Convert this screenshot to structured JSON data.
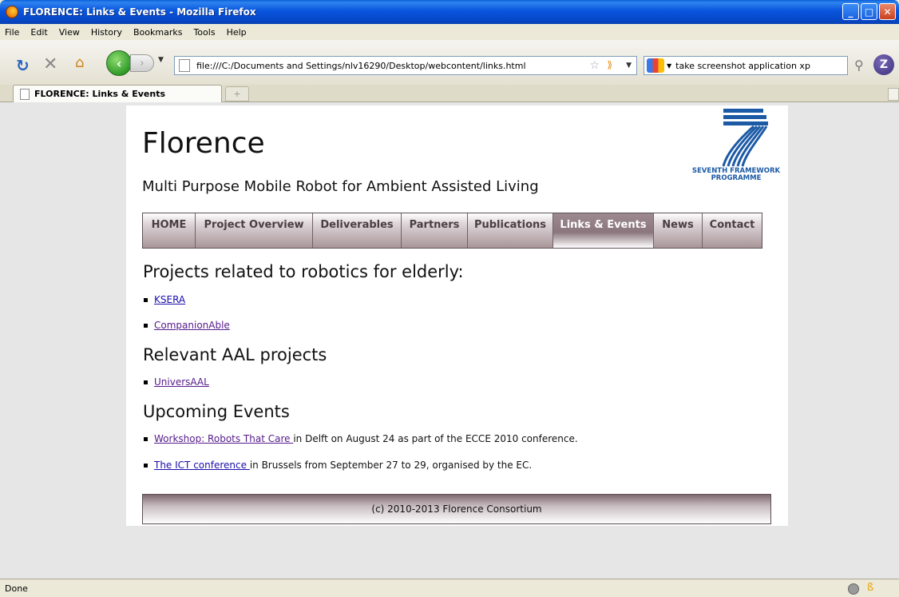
{
  "window": {
    "title": "FLORENCE: Links & Events - Mozilla Firefox"
  },
  "menu": [
    "File",
    "Edit",
    "View",
    "History",
    "Bookmarks",
    "Tools",
    "Help"
  ],
  "toolbar": {
    "url": "file:///C:/Documents and Settings/nlv16290/Desktop/webcontent/links.html",
    "search_value": "take screenshot application xp"
  },
  "tabs": [
    {
      "label": "FLORENCE: Links & Events"
    }
  ],
  "site": {
    "title": "Florence",
    "subtitle": "Multi Purpose Mobile Robot for Ambient Assisted Living",
    "logo_text_line1": "SEVENTH FRAMEWORK",
    "logo_text_line2": "PROGRAMME"
  },
  "nav": [
    {
      "label": "HOME",
      "active": false
    },
    {
      "label": "Project Overview",
      "active": false
    },
    {
      "label": "Deliverables",
      "active": false
    },
    {
      "label": "Partners",
      "active": false
    },
    {
      "label": "Publications",
      "active": false
    },
    {
      "label": "Links & Events",
      "active": true
    },
    {
      "label": "News",
      "active": false
    },
    {
      "label": "Contact",
      "active": false
    }
  ],
  "sections": {
    "robotics_heading": "Projects related to robotics for elderly:",
    "robotics_links": [
      "KSERA",
      "CompanionAble"
    ],
    "aal_heading": "Relevant AAL projects",
    "aal_links": [
      "UniversAAL"
    ],
    "events_heading": "Upcoming Events",
    "events": [
      {
        "link": "Workshop: Robots That Care ",
        "text": "in Delft on August 24 as part of the ECCE 2010 conference."
      },
      {
        "link": "The ICT conference ",
        "text": "in Brussels from September 27 to 29, organised by the EC."
      }
    ]
  },
  "footer": "(c) 2010-2013 Florence Consortium",
  "status": "Done",
  "icons": {
    "reload": "reload-icon",
    "stop": "stop-icon",
    "home": "home-icon",
    "back": "back-arrow-icon",
    "forward": "forward-arrow-icon",
    "bookmark_star": "star-icon",
    "rss": "rss-icon",
    "search": "magnifier-icon"
  },
  "colors": {
    "titlebar": "#0855dd",
    "nav_active": "#8a767c",
    "link": "#1a0dab",
    "visited_link": "#551a8b"
  }
}
